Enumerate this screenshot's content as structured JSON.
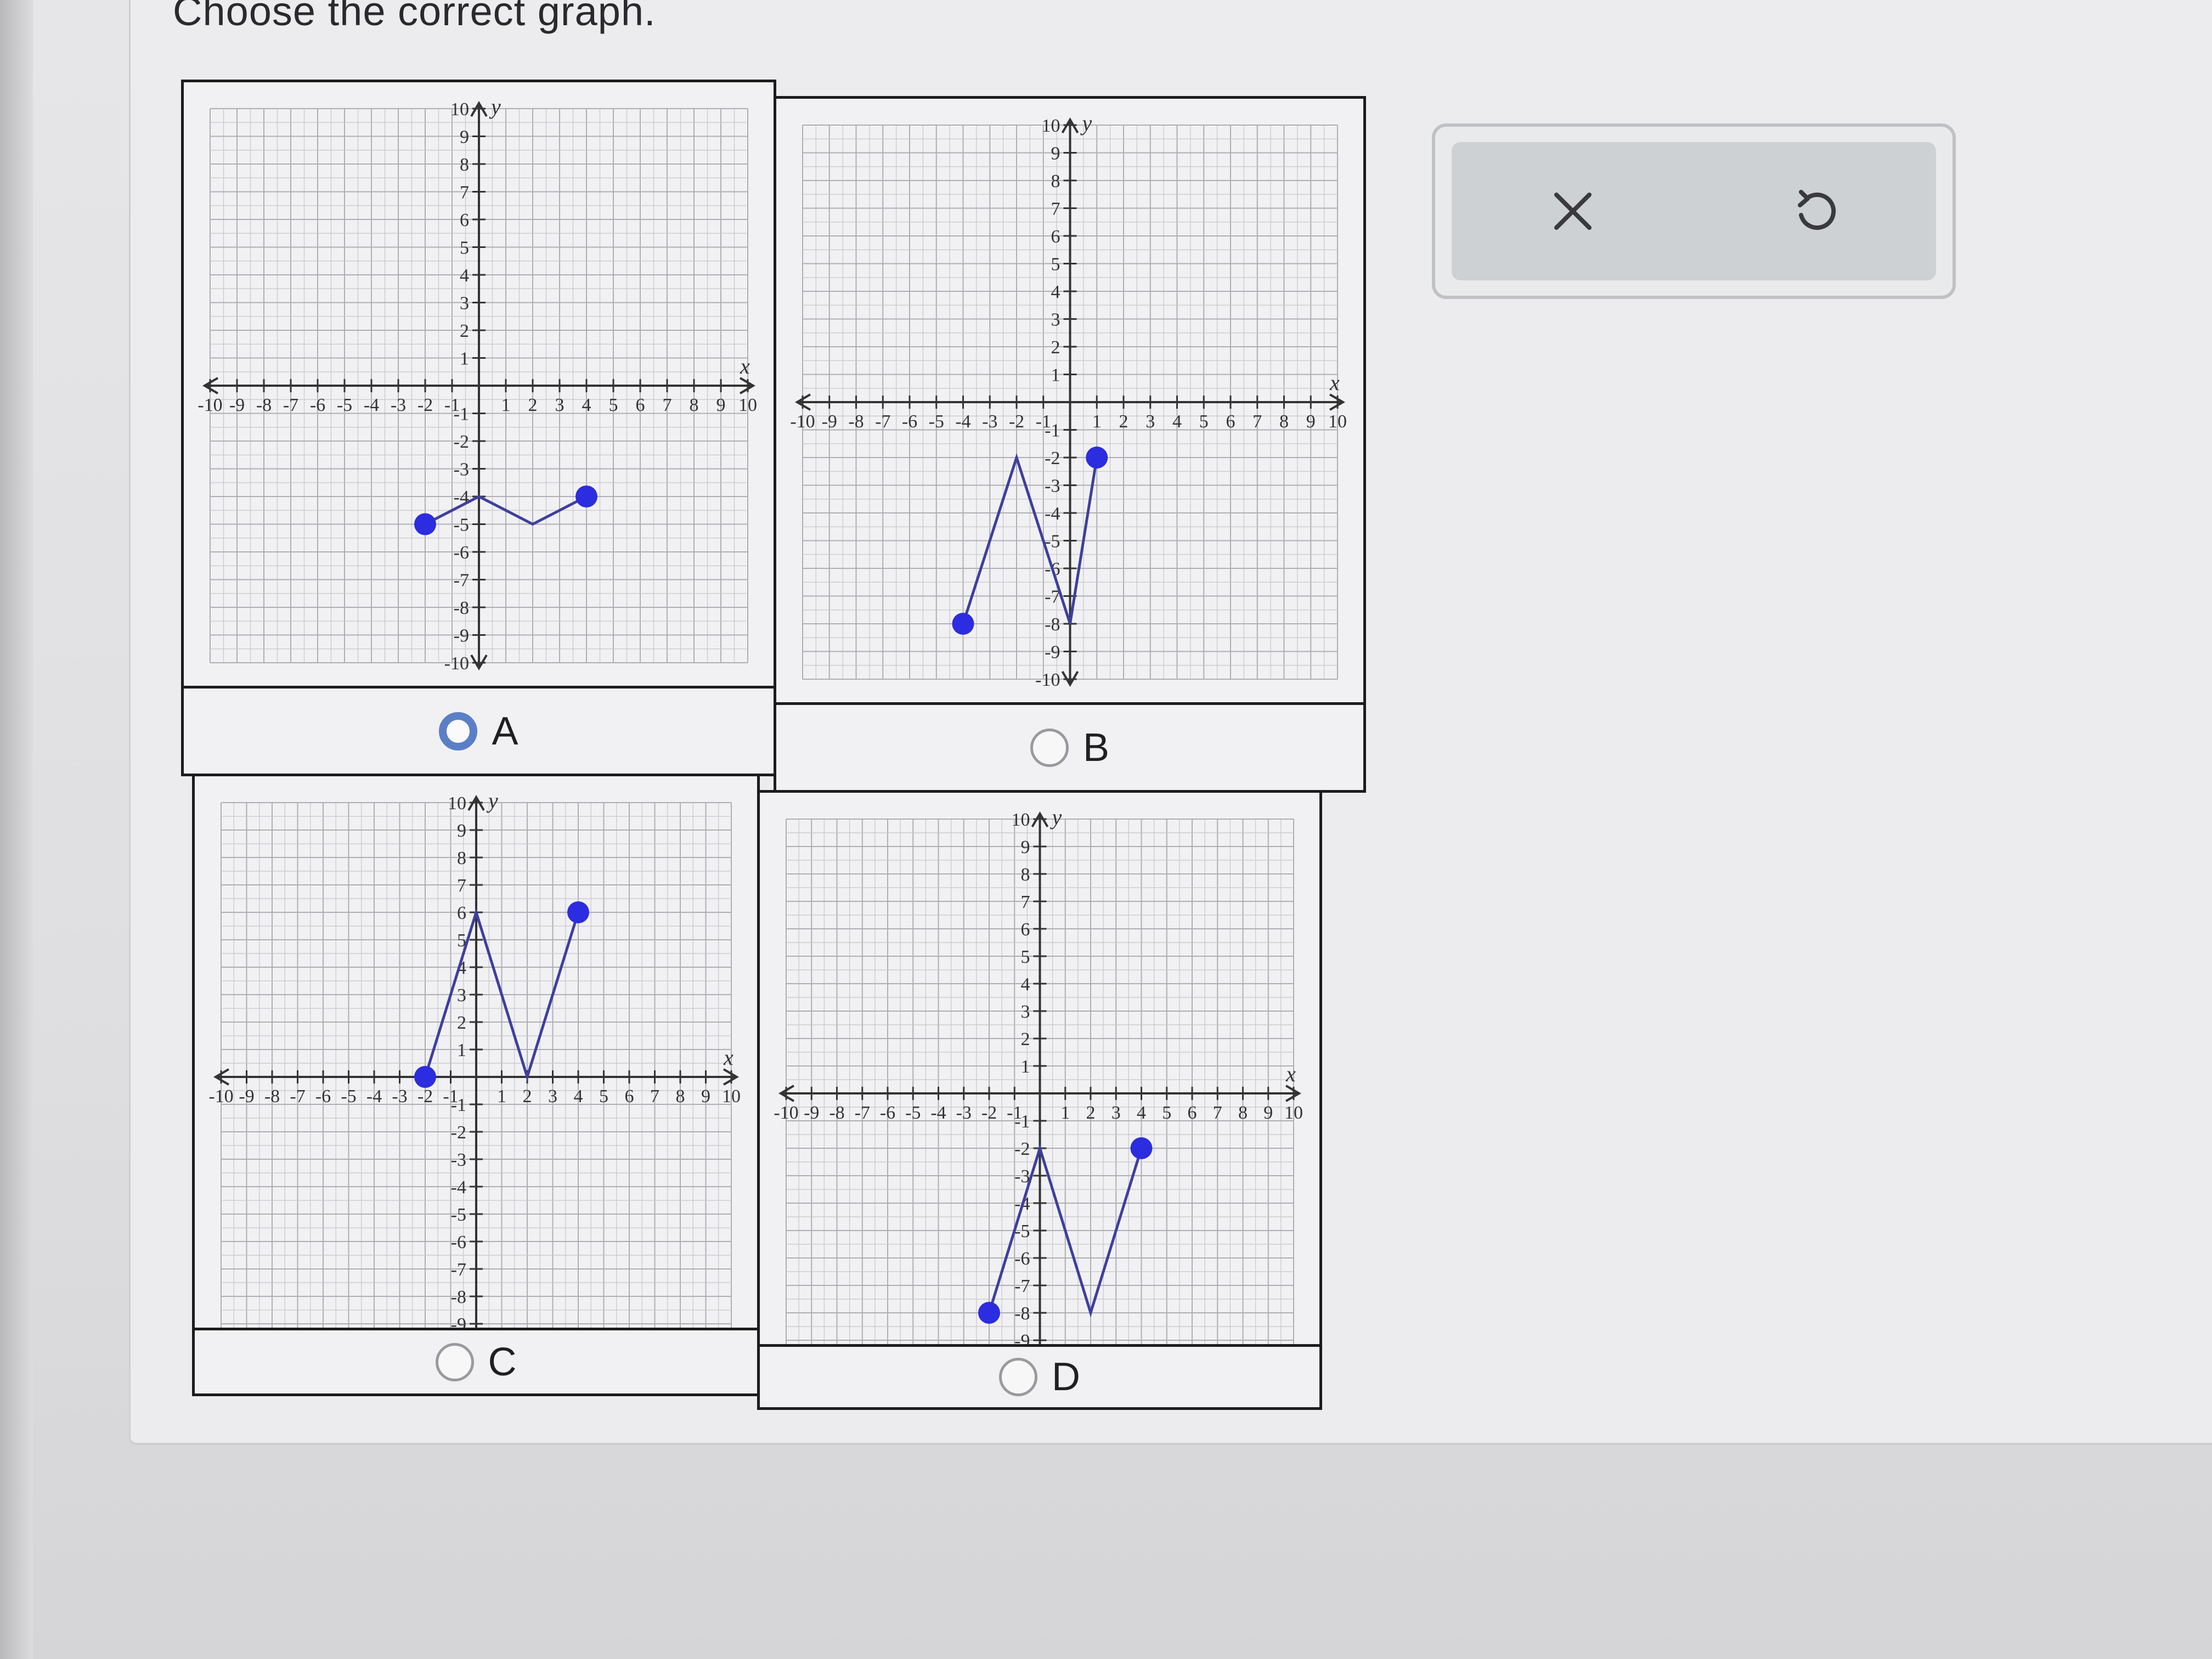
{
  "prompt": "Choose the correct graph.",
  "choices": [
    {
      "label": "A",
      "selected": true
    },
    {
      "label": "B",
      "selected": false
    },
    {
      "label": "C",
      "selected": false
    },
    {
      "label": "D",
      "selected": false
    }
  ],
  "axis": {
    "min": -10,
    "max": 10,
    "x_name": "x",
    "y_name": "y",
    "x_tick_labels": [
      "-10",
      "-9",
      "-8",
      "-7",
      "-6",
      "-5",
      "-4",
      "-3",
      "-2",
      "-1",
      "1",
      "2",
      "3",
      "4",
      "5",
      "6",
      "7",
      "8",
      "9",
      "10"
    ],
    "y_tick_labels": [
      "10",
      "9",
      "8",
      "7",
      "6",
      "5",
      "4",
      "3",
      "2",
      "1",
      "-1",
      "-2",
      "-3",
      "-4",
      "-5",
      "-6",
      "-7",
      "-8",
      "-9",
      "-10"
    ]
  },
  "chart_data": [
    {
      "type": "line",
      "label": "A",
      "x": [
        -2,
        0,
        2,
        4
      ],
      "y": [
        -5,
        -4,
        -5,
        -4
      ],
      "xlim": [
        -10,
        10
      ],
      "ylim": [
        -10,
        10
      ],
      "grid": true
    },
    {
      "type": "line",
      "label": "B",
      "x": [
        -4,
        -2,
        0,
        1
      ],
      "y": [
        -8,
        -2,
        -8,
        -2
      ],
      "xlim": [
        -10,
        10
      ],
      "ylim": [
        -10,
        10
      ],
      "grid": true
    },
    {
      "type": "line",
      "label": "C",
      "x": [
        -2,
        0,
        2,
        4
      ],
      "y": [
        0,
        6,
        0,
        6
      ],
      "xlim": [
        -10,
        10
      ],
      "ylim": [
        -10,
        10
      ],
      "grid": true
    },
    {
      "type": "line",
      "label": "D",
      "x": [
        -2,
        0,
        2,
        4
      ],
      "y": [
        -8,
        -2,
        -8,
        -2
      ],
      "xlim": [
        -10,
        10
      ],
      "ylim": [
        -10,
        10
      ],
      "grid": true
    }
  ],
  "colors": {
    "line": "#3f3f9e",
    "point": "#2c2ce0",
    "axis": "#333333",
    "grid_minor": "#c7c7cc",
    "grid_major": "#aeaeb4"
  },
  "toolbar": {
    "clear_icon": "close-icon",
    "undo_icon": "undo-icon"
  }
}
